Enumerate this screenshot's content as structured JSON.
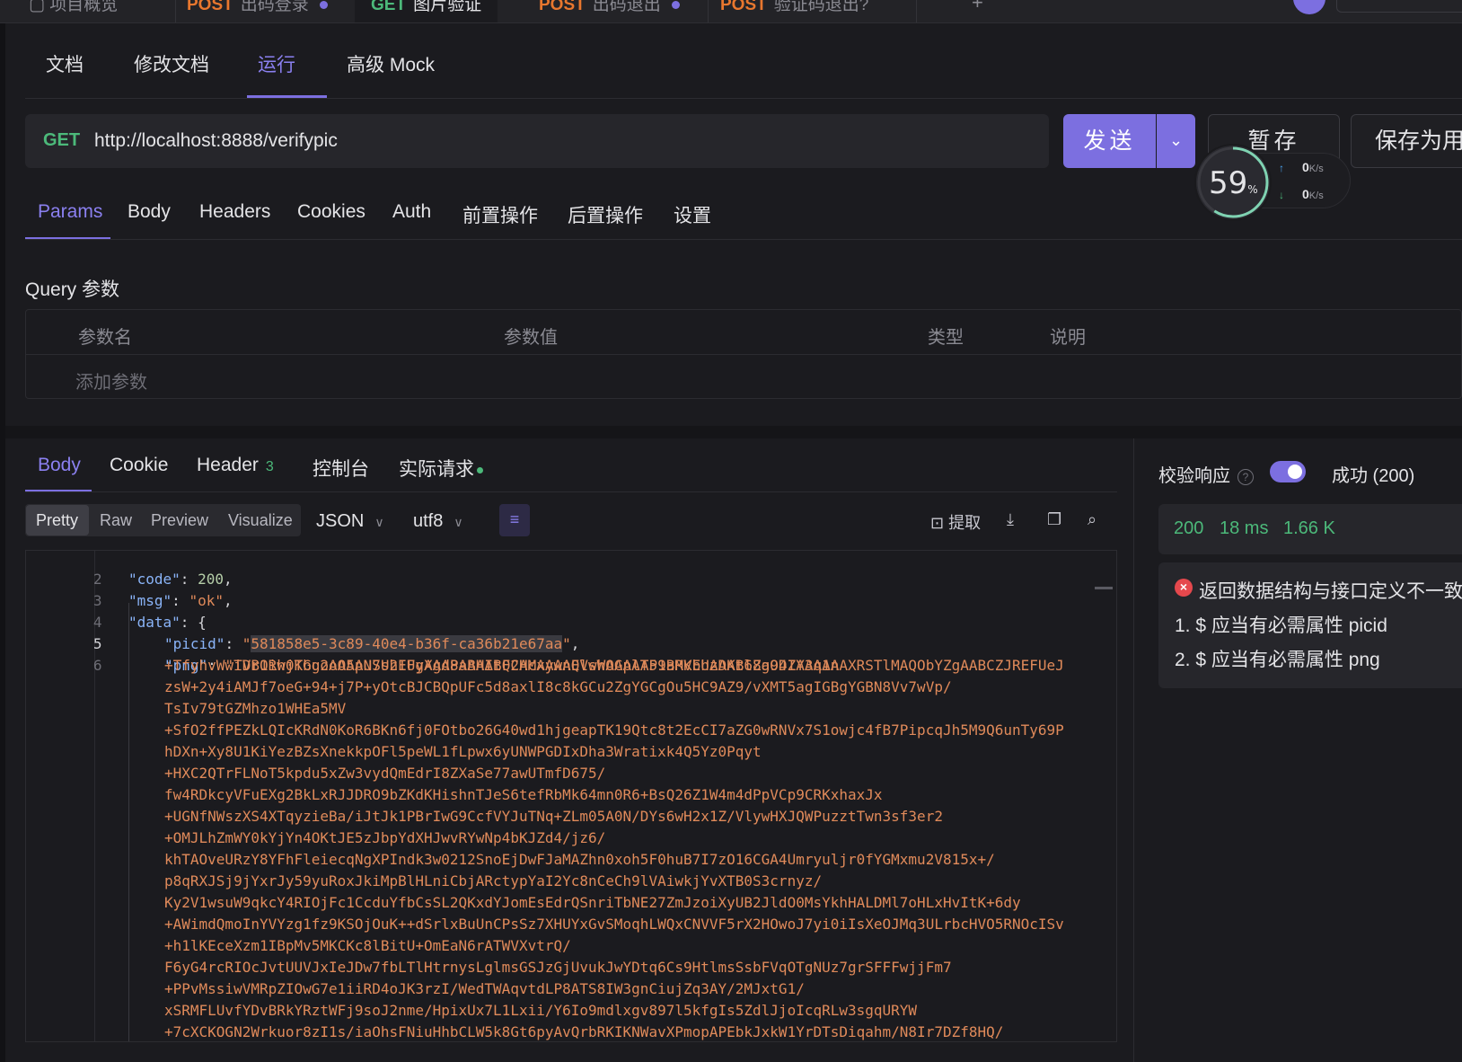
{
  "top_tabs": [
    {
      "method": "",
      "label": "项目概览"
    },
    {
      "method": "POST",
      "label": "出码登录"
    },
    {
      "method": "GET",
      "label": "图片验证"
    },
    {
      "method": "POST",
      "label": "出码退出"
    },
    {
      "method": "POST",
      "label": "验证码退出?"
    }
  ],
  "main_tabs": [
    "文档",
    "修改文档",
    "运行",
    "高级 Mock"
  ],
  "request": {
    "method": "GET",
    "url": "http://localhost:8888/verifypic",
    "send_label": "发送",
    "stash_label": "暂存",
    "save_as_label": "保存为用例"
  },
  "speed": {
    "percent": "59",
    "percent_unit": "%",
    "up": "0",
    "down": "0",
    "unit": "K/s"
  },
  "request_tabs": [
    "Params",
    "Body",
    "Headers",
    "Cookies",
    "Auth",
    "前置操作",
    "后置操作",
    "设置"
  ],
  "query": {
    "title": "Query 参数",
    "headers": [
      "参数名",
      "参数值",
      "类型",
      "说明"
    ],
    "add_placeholder": "添加参数"
  },
  "response_tabs": {
    "body": "Body",
    "cookie": "Cookie",
    "header": "Header",
    "header_count": "3",
    "console": "控制台",
    "actual_request": "实际请求"
  },
  "view_modes": [
    "Pretty",
    "Raw",
    "Preview",
    "Visualize"
  ],
  "format": "JSON",
  "encoding": "utf8",
  "toolbar": {
    "extract_label": "提取"
  },
  "code": {
    "line_numbers": [
      "2",
      "3",
      "4",
      "5",
      "6"
    ],
    "code_key": "\"code\"",
    "code_value": "200",
    "msg_key": "\"msg\"",
    "msg_value": "\"ok\"",
    "data_key": "\"data\"",
    "picid_key": "\"picid\"",
    "picid_value": "581858e5-3c89-40e4-b36f-ca36b21e67aa",
    "png_key": "\"png\"",
    "png_first": "\"iVBORw0KGgoAAAANSUhEUgAAAPAAAABQCAMAAAAQlwhOAAAAP1BMVEUAAAB6Zg94ZA3q1n",
    "png_continuation": [
      "+TfyhvWwTDr1ihjTbu2oO5pU7s2IFyXgd8aBHItF2HcxywnEVsWAGplT59aRKbhzDKtl8aODIYAAAAAXRSTlMAQObYZgAABCZJREFUeJ",
      "zsW+2y4iAMJf7oeG+94+j7P+yOtcBJCBQpUFc5d8axlI8c8kGCu2ZgYGCgOu5HC9AZ9/vXMT5agIGBgYGBN8Vv7wVp/",
      "TsIv79tGZMhzo1WHEa5MV",
      "+SfO2ffPEZkLQIcKRdN0KoR6BKn6fj0FOtbo26G40wd1hjgeapTK19Qtc8t2EcCI7aZG0wRNVx7S1owjc4fB7PipcqJh5M9Q6unTy69P",
      "hDXn+Xy8U1KiYezBZsXnekkpOFl5peWL1fLpwx6yUNWPGDIxDha3Wratixk4Q5Yz0Pqyt",
      "+HXC2QTrFLNoT5kpdu5xZw3vydQmEdrI8ZXaSe77awUTmfD675/",
      "fw4RDkcyVFuEXg2BkLxRJJDRO9bZKdKHishnTJeS6tefRbMk64mn0R6+BsQ26Z1W4m4dPpVCp9CRKxhaxJx",
      "+UGNfNWszXS4XTqyzieBa/iJtJk1PBrIwG9CcfVYJuTNq+ZLm05A0N/DYs6wH2x1Z/VlywHXJQWPuzztTwn3sf3er2",
      "+OMJLhZmWY0kYjYn4OKtJE5zJbpYdXHJwvRYwNp4bKJZd4/jz6/",
      "khTAOveURzY8YFhFleiecqNgXPIndk3w0212SnoEjDwFJaMAZhn0xoh5F0huB7I7zO16CGA4Umryuljr0fYGMxmu2V815x+/",
      "p8qRXJSj9jYxrJy59yuRoxJkiMpBlHLniCbjARctypYaI2Yc8nCeCh9lVAiwkjYvXTB0S3crnyz/",
      "Ky2V1wsuW9qkcY4RIOjFc1CcduYfbCsSL2QKxdYJomEsEdrQSnriTbNE27ZmJzoiXyUB2JldO0MsYkhHALDMl7oHLxHvItK+6dy",
      "+AWimdQmoInYVYzg1fz9KSOjOuK++dSrlxBuUnCPsSz7XHUYxGvSMoqhLWQxCNVVF5rX2HOwoJ7yi0iIsXeOJMq3ULrbcHVO5RNOcISv",
      "+h1lKEceXzm1IBpMv5MKCKc8lBitU+OmEaN6rATWVXvtrQ/",
      "F6yG4rcRIOcJvtUUVJxIeJDw7fbLTlHtrnysLglmsGSJzGjUvukJwYDtq6Cs9HtlmsSsbFVqOTgNUz7grSFFFwjjFm7",
      "+PPvMssiwVMRpZIOwG7e1iiRD4oJK3rzI/WedTWAqvtdLP8ATS8IW3gnCiujZq3AY/2MJxtG1/",
      "xSRMFLUvfYDvBRkYRztWFj9soJ2nme/HpixUx7L1Lxii/Y6Io9mdlxgv897l5kfgIs5ZdlJjoIcqRLw3sgqURYW",
      "+7cXCKOGN2Wrkuor8zI1s/iaOhsFNiuHhbCLW5k8Gt6pyAvQrbRKIKNWavXPmopAPEbkJxkW1YrDTsDiqahm/N8Ir7DZf8HQ/"
    ]
  },
  "validation": {
    "label": "校验响应",
    "status": "成功 (200)",
    "code": "200",
    "time": "18 ms",
    "size": "1.66 K",
    "error_title": "返回数据结构与接口定义不一致",
    "errors": [
      "1. $ 应当有必需属性 picid",
      "2. $ 应当有必需属性 png"
    ]
  },
  "colors": {
    "accent": "#7c6fe0",
    "get_method": "#4cb97a",
    "post_method": "#e8772e",
    "string": "#e08a5a",
    "key": "#8ab4f8",
    "error": "#e5484d"
  }
}
